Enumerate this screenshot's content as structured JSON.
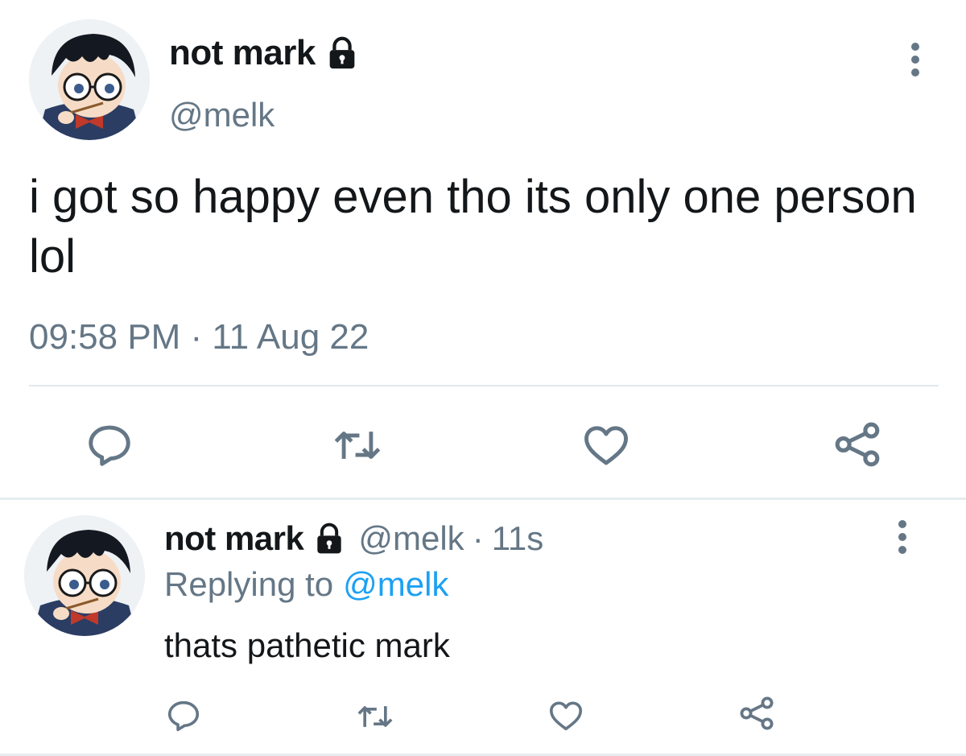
{
  "main_tweet": {
    "display_name": "not mark",
    "handle": "@melk",
    "text": "i got so happy even tho its only one person lol",
    "timestamp": "09:58 PM · 11 Aug 22",
    "icons": {
      "protected": "lock-icon",
      "more": "more-vertical-icon",
      "reply": "reply-icon",
      "retweet": "retweet-icon",
      "like": "heart-icon",
      "share": "share-icon"
    }
  },
  "reply_tweet": {
    "display_name": "not mark",
    "handle": "@melk",
    "separator": "·",
    "time_ago": "11s",
    "replying_prefix": "Replying to",
    "replying_target": "@melk",
    "text": "thats pathetic mark"
  },
  "colors": {
    "text_primary": "#14171a",
    "text_secondary": "#657786",
    "accent_link": "#1da1f2",
    "divider": "#e1e8ed",
    "icon_gray": "#657786"
  }
}
